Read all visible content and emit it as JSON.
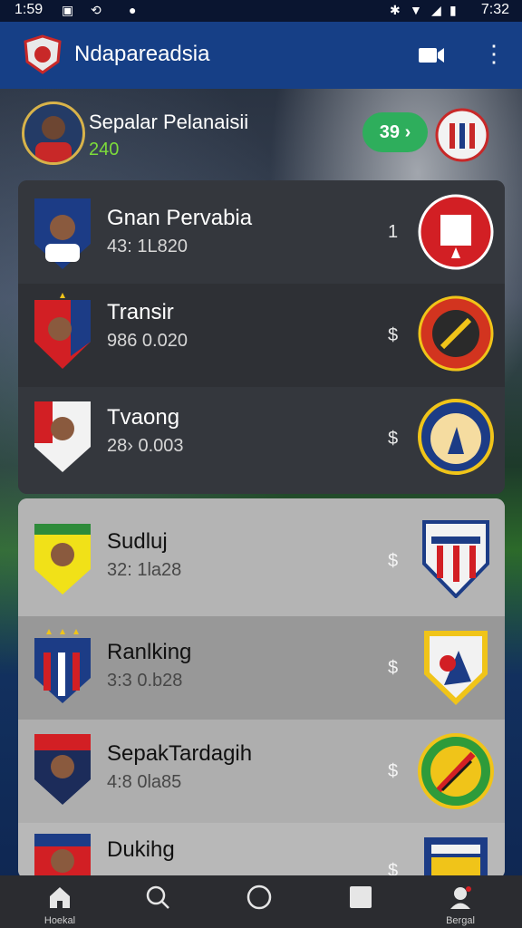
{
  "status_bar": {
    "time_left": "1:59",
    "time_right": "7:32"
  },
  "app": {
    "title": "Ndapareadsia"
  },
  "profile": {
    "name": "Sepalar Pelanaisii",
    "score": "240",
    "pill_value": "39",
    "pill_icon": "chevron-right-icon"
  },
  "colors": {
    "appbar": "#163f86",
    "accent_green": "#2eae5c",
    "score_green": "#7ddc3a"
  },
  "dark_list": [
    {
      "name": "Gnan Pervabia",
      "stat": "43: 1L820",
      "currency": "1"
    },
    {
      "name": "Transir",
      "stat": "986 0.020",
      "currency": "$"
    },
    {
      "name": "Tvaong",
      "stat": "28› 0.003",
      "currency": "$"
    }
  ],
  "light_list": [
    {
      "name": "Sudluj",
      "stat": "32: 1la28",
      "currency": "$"
    },
    {
      "name": "Ranlking",
      "stat": "3:3 0.b28",
      "currency": "$"
    },
    {
      "name": "SepakTardagih",
      "stat": "4:8 0la85",
      "currency": "$"
    },
    {
      "name": "Dukihg",
      "stat": "",
      "currency": "$"
    }
  ],
  "nav": [
    {
      "icon": "home-icon",
      "label": "Hoekal"
    },
    {
      "icon": "search-icon",
      "label": ""
    },
    {
      "icon": "circle-icon",
      "label": ""
    },
    {
      "icon": "square-icon",
      "label": ""
    },
    {
      "icon": "profile-icon",
      "label": "Bergal"
    }
  ]
}
